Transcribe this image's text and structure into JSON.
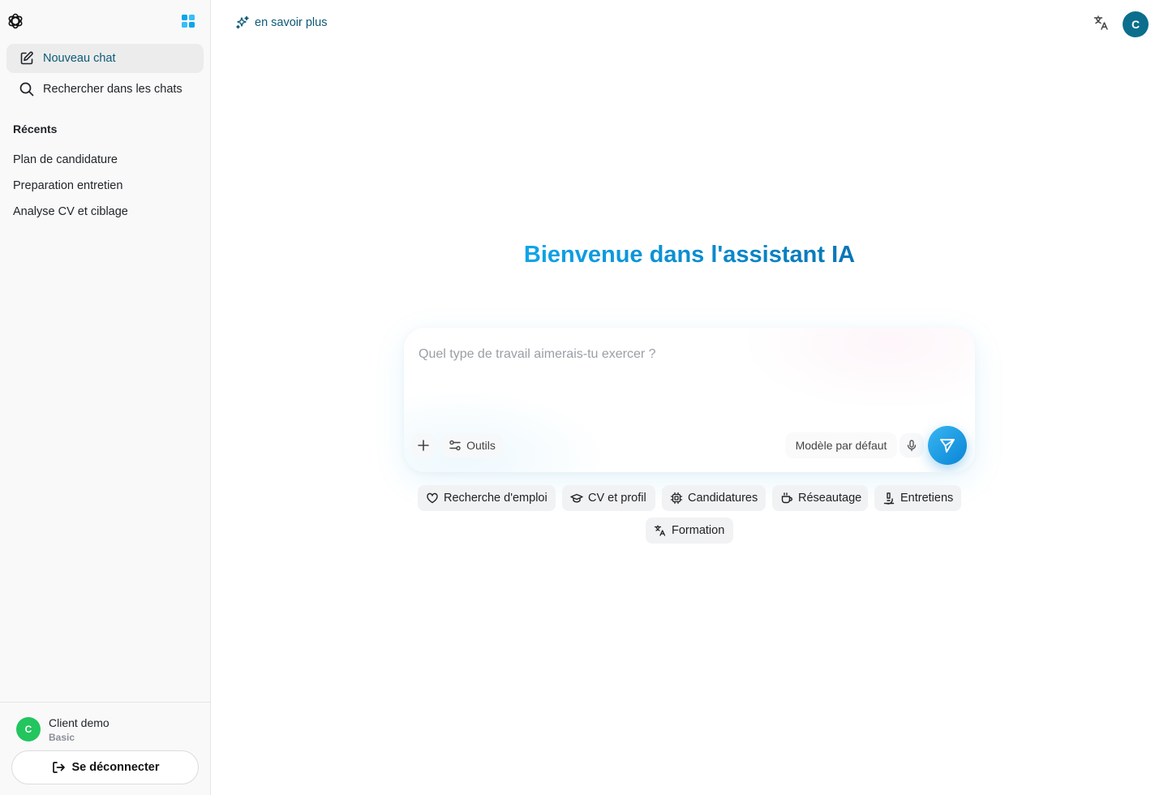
{
  "colors": {
    "accent": "#0b5a76",
    "welcome_gradient_start": "#0ea5e9",
    "welcome_gradient_end": "#0876b5",
    "user_avatar_bg": "#22c55e",
    "top_avatar_bg": "#0b6e8c",
    "send_button": "#0a84d6",
    "sidebar_bg": "#f9f9f9"
  },
  "sidebar": {
    "logo_icon": "openai-logo-icon",
    "toggle_icon": "grid-squares-icon",
    "new_chat": {
      "label": "Nouveau chat",
      "icon": "edit-square-icon"
    },
    "search_chats": {
      "label": "Rechercher dans les chats",
      "icon": "search-icon"
    },
    "recents_title": "Récents",
    "recents": [
      {
        "label": "Plan de candidature"
      },
      {
        "label": "Preparation entretien"
      },
      {
        "label": "Analyse CV et ciblage"
      }
    ],
    "user": {
      "initial": "C",
      "name": "Client demo",
      "plan": "Basic"
    },
    "logout": {
      "label": "Se déconnecter",
      "icon": "logout-icon"
    }
  },
  "header": {
    "learn_more": {
      "label": "en savoir plus",
      "icon": "sparkles-icon"
    },
    "translate_icon": "translate-icon",
    "avatar_initial": "C"
  },
  "main": {
    "welcome": "Bienvenue dans l'assistant IA",
    "composer": {
      "placeholder": "Quel type de travail aimerais-tu exercer ?",
      "value": "",
      "plus_icon": "plus-icon",
      "tools_label": "Outils",
      "tools_icon": "sliders-icon",
      "model_label": "Modèle par défaut",
      "mic_icon": "microphone-icon",
      "send_icon": "paper-plane-icon"
    },
    "chips": [
      {
        "label": "Recherche d'emploi",
        "icon": "heart-icon"
      },
      {
        "label": "CV et profil",
        "icon": "graduation-cap-icon"
      },
      {
        "label": "Candidatures",
        "icon": "chip-cpu-icon"
      },
      {
        "label": "Réseautage",
        "icon": "coffee-cup-icon"
      },
      {
        "label": "Entretiens",
        "icon": "microscope-icon"
      },
      {
        "label": "Formation",
        "icon": "translate-icon"
      }
    ]
  }
}
